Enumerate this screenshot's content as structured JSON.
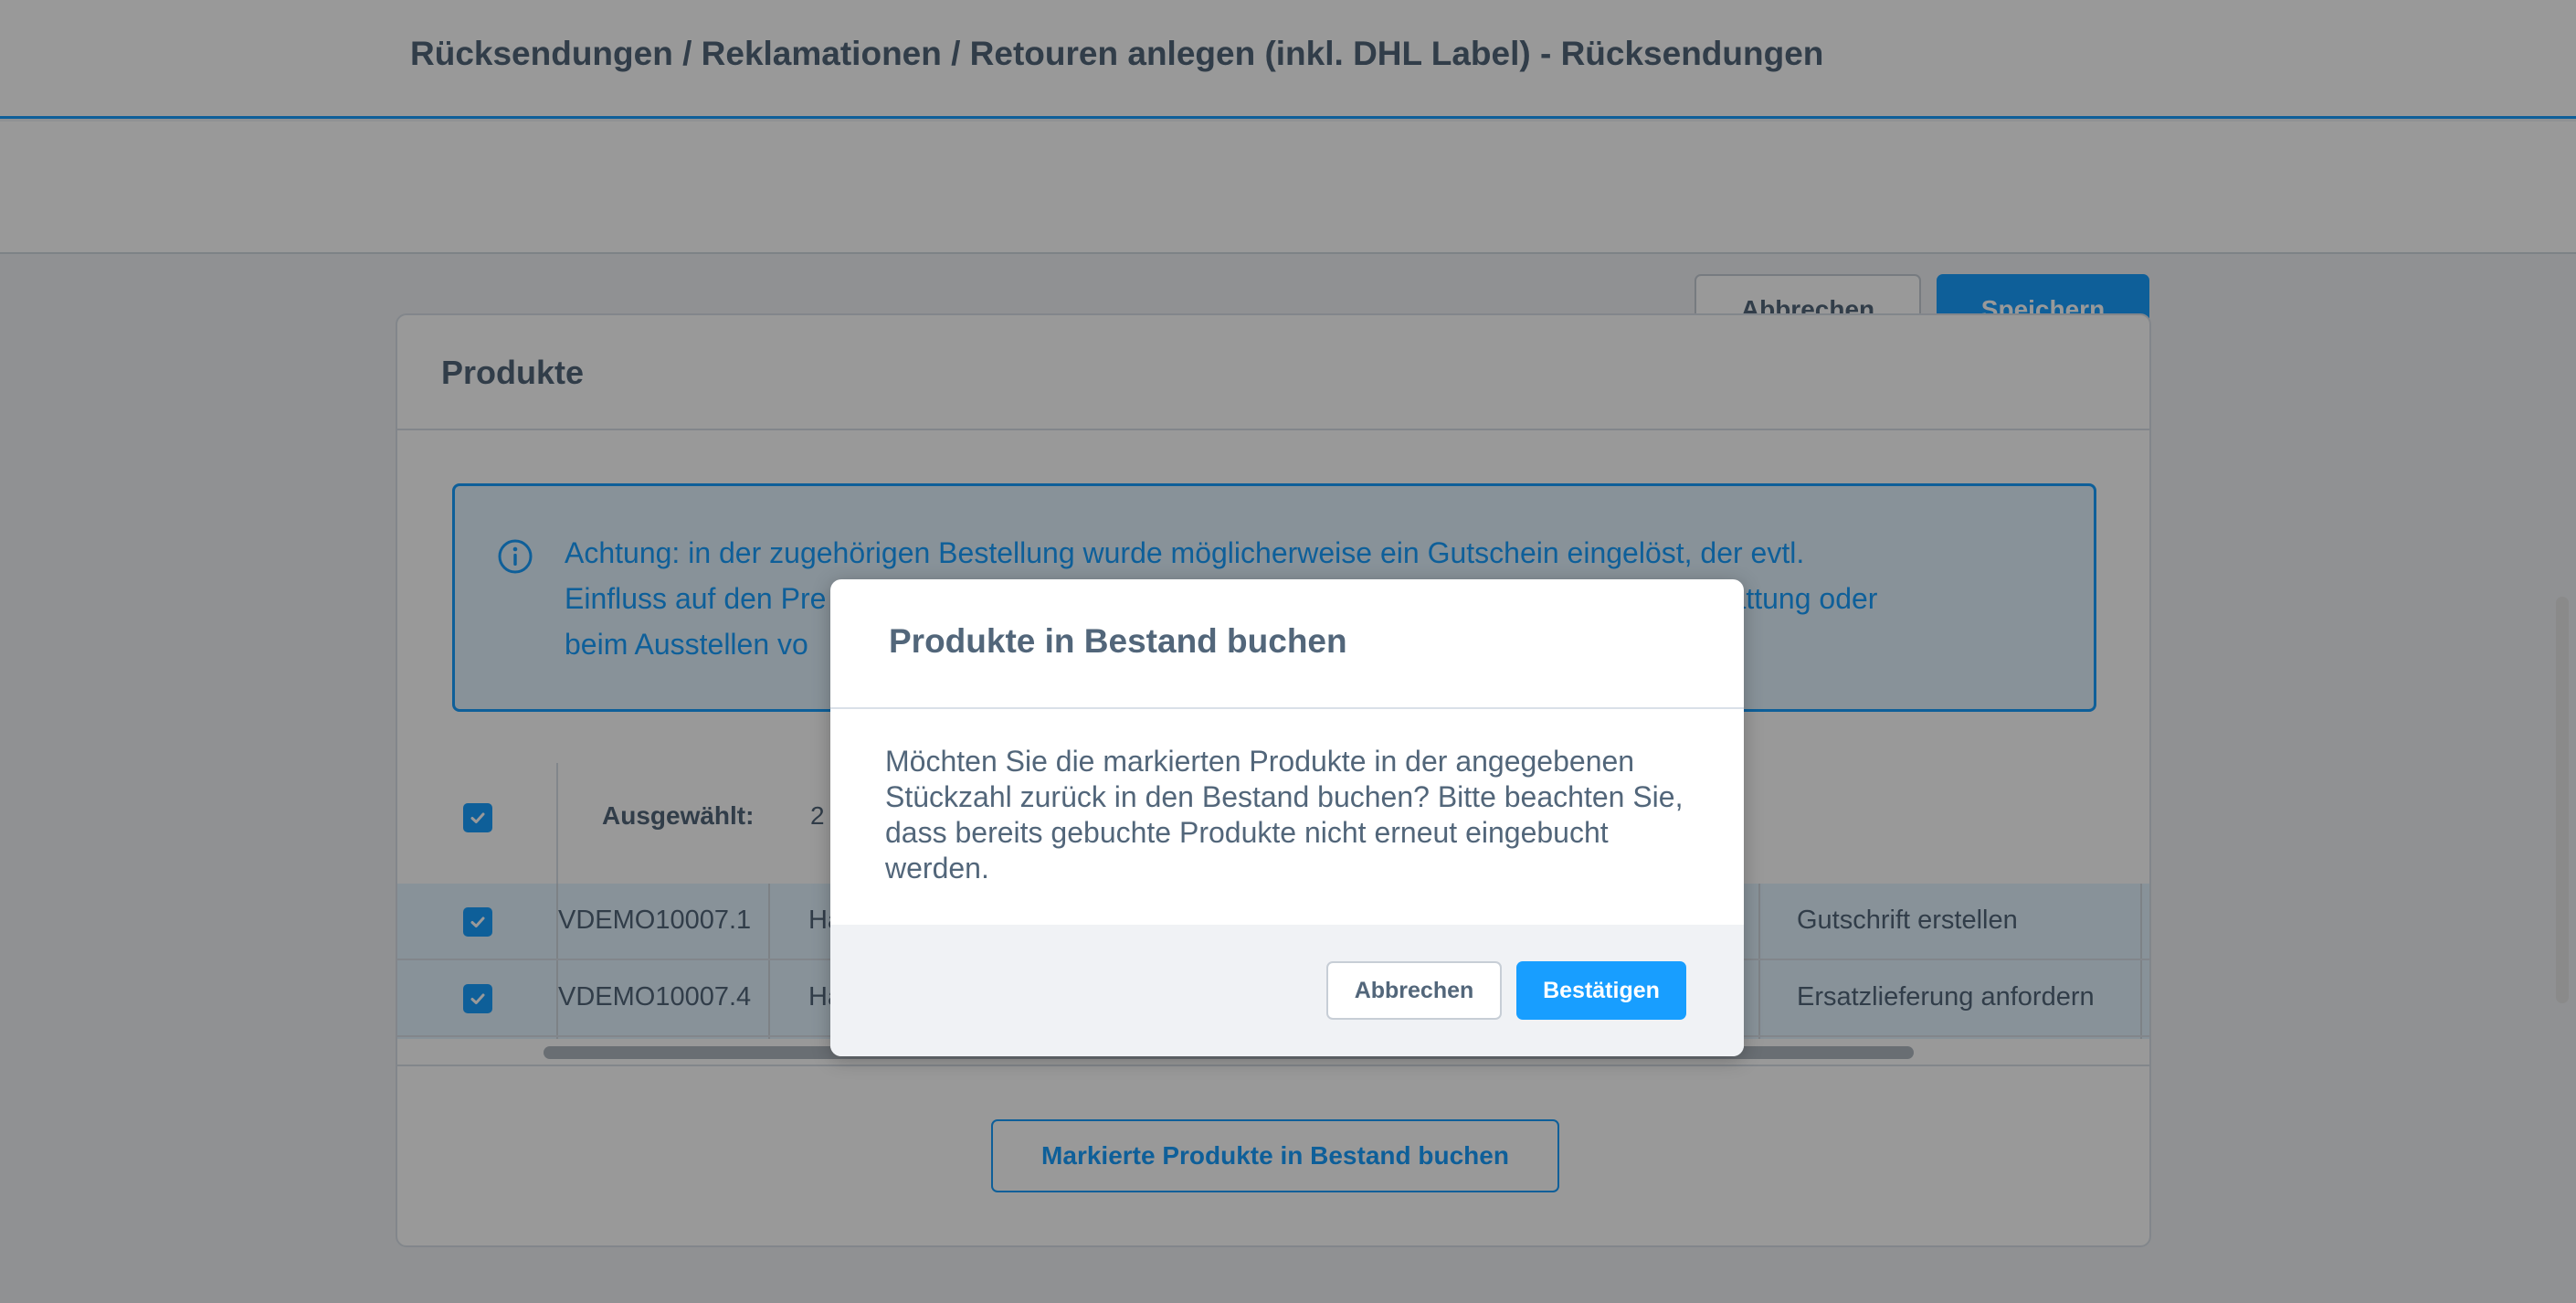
{
  "header": {
    "title": "Rücksendungen / Reklamationen / Retouren anlegen (inkl. DHL Label) - Rücksendungen"
  },
  "toolbar": {
    "cancel_label": "Abbrechen",
    "save_label": "Speichern"
  },
  "card": {
    "title": "Produkte",
    "alert_text": "Achtung: in der zugehörigen Bestellung wurde möglicherweise ein Gutschein eingelöst, der evtl. Einfluss auf den Preis der Produkte hat. Bitte beachten Sie dies bei einer Rückerstattung oder beim Ausstellen von Gutschriften.",
    "alert_line1": "Achtung: in der zugehörigen Bestellung wurde möglicherweise ein Gutschein eingelöst, der evtl.",
    "alert_line2_visible_start": "Einfluss auf den Pre",
    "alert_line2_visible_end": "rstattung oder",
    "alert_line3_visible_start": "beim Ausstellen vo",
    "selection": {
      "label": "Ausgewählt:",
      "count": "2"
    },
    "rows": [
      {
        "number": "VDEMO10007.1",
        "name_fragment": "Ha",
        "action": "Gutschrift erstellen",
        "checked": true
      },
      {
        "number": "VDEMO10007.4",
        "name_fragment": "Ha",
        "action": "Ersatzlieferung anfordern",
        "checked": true
      }
    ],
    "mark_button_label": "Markierte Produkte in Bestand buchen"
  },
  "modal": {
    "title": "Produkte in Bestand buchen",
    "body": "Möchten Sie die markierten Produkte in der angegebenen Stückzahl zurück in den Bestand buchen? Bitte beachten Sie, dass bereits gebuchte Produkte nicht erneut eingebucht werden.",
    "cancel_label": "Abbrechen",
    "confirm_label": "Bestätigen"
  },
  "colors": {
    "accent": "#189eff",
    "text": "#52667a",
    "alert_bg": "#e3f3ff"
  },
  "icons": {
    "info": "info-circle-icon",
    "check": "checkmark-icon"
  }
}
